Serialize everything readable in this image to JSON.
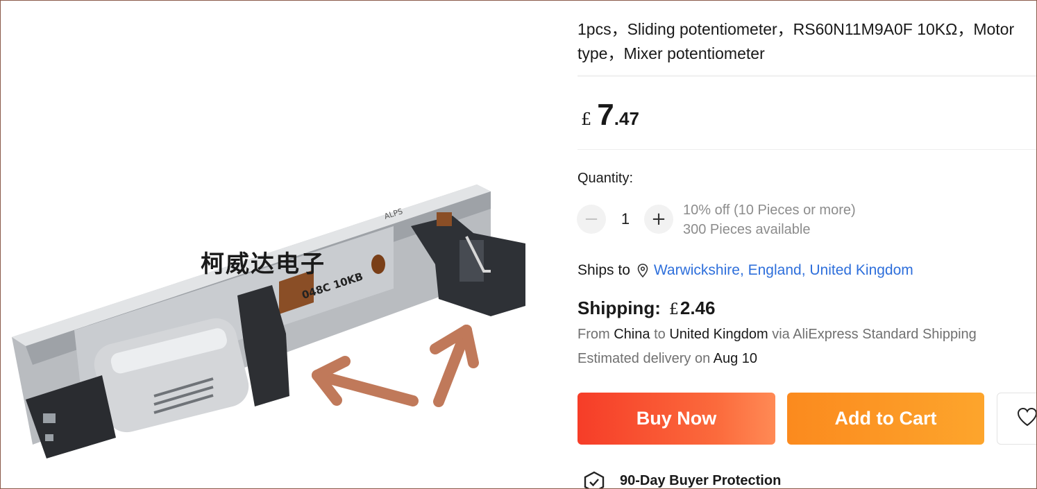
{
  "product": {
    "title_line1": "1pcs，Sliding potentiometer，RS60N11M9A0F 10KΩ，Motor",
    "title_line2": "type，Mixer potentiometer",
    "image_watermark": "柯威达电子",
    "image_print": "048C 10KB",
    "image_brand": "ALPS"
  },
  "price": {
    "currency": "£",
    "integer": "7",
    "decimal": ".47"
  },
  "quantity": {
    "label": "Quantity:",
    "value": "1",
    "minus_glyph": "−",
    "plus_glyph": "+",
    "discount_note": "10% off (10 Pieces or more)",
    "available": "300 Pieces available"
  },
  "ships": {
    "label": "Ships to",
    "location": "Warwickshire, England, United Kingdom"
  },
  "shipping": {
    "label": "Shipping:",
    "currency": "£",
    "amount": "2.46",
    "from_word": "From",
    "from": "China",
    "to_word": "to",
    "to": "United Kingdom",
    "via_text": "via AliExpress Standard Shipping",
    "delivery_text": "Estimated delivery on",
    "delivery_date": "Aug 10"
  },
  "actions": {
    "buy_now": "Buy Now",
    "add_to_cart": "Add to Cart"
  },
  "protection": {
    "label": "90-Day Buyer Protection"
  },
  "colors": {
    "buy_gradient_start": "#f63d28",
    "cart_gradient_start": "#fb8a1e",
    "link": "#2e6fdb",
    "arrow": "#c0795a"
  },
  "icons": {
    "location": "location-pin-icon",
    "wishlist": "heart-icon",
    "protection": "shield-check-icon"
  }
}
